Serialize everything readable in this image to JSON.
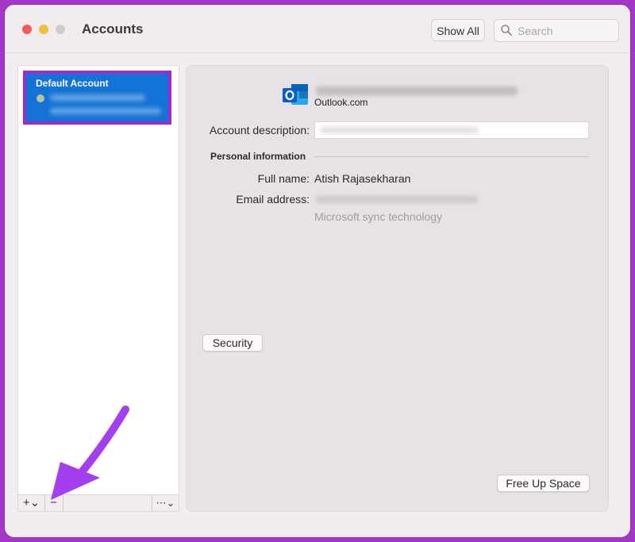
{
  "window": {
    "title": "Accounts",
    "show_all_label": "Show All",
    "search_placeholder": "Search"
  },
  "sidebar": {
    "accounts": [
      {
        "name": "Default Account",
        "selected": true
      }
    ],
    "toolbar": {
      "add_label": "+⌄",
      "remove_label": "−",
      "more_label": "⋯⌄"
    }
  },
  "detail": {
    "provider": "Outlook.com",
    "provider_icon": "outlook-icon",
    "account_description_label": "Account description:",
    "personal_info_heading": "Personal information",
    "full_name_label": "Full name:",
    "full_name_value": "Atish Rajasekharan",
    "email_label": "Email address:",
    "sync_note": "Microsoft sync technology",
    "security_button": "Security",
    "free_up_space_button": "Free Up Space"
  },
  "colors": {
    "selection": "#1473d6",
    "highlight_border": "#9a2bd0",
    "annotation_arrow": "#a43ff0"
  }
}
